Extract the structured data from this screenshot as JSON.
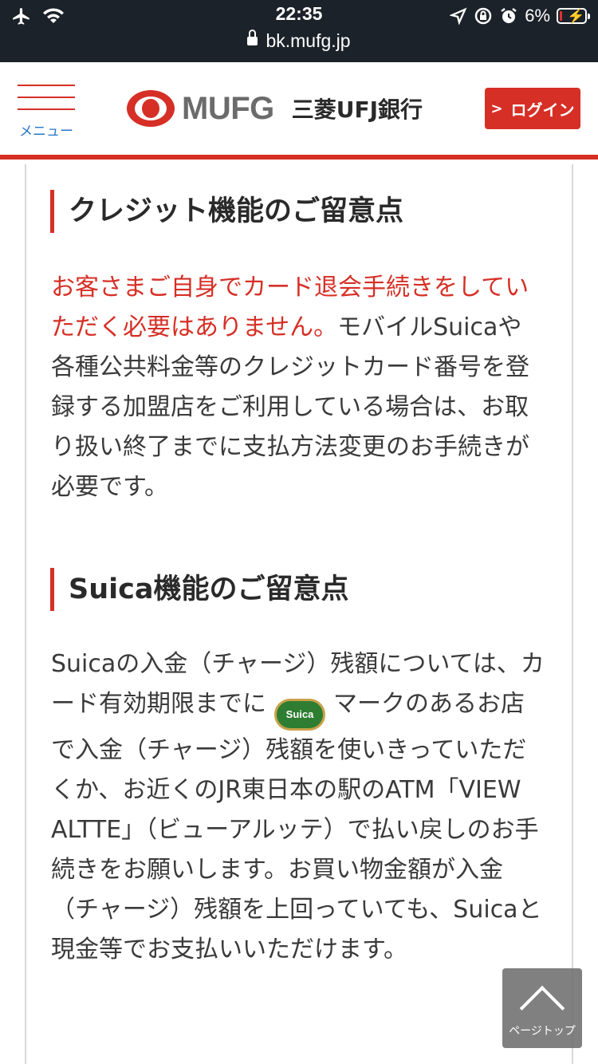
{
  "status_bar": {
    "time": "22:35",
    "battery": "6%",
    "url": "bk.mufg.jp"
  },
  "header": {
    "menu_label": "メニュー",
    "logo_text": "MUFG",
    "bank_name": "三菱UFJ銀行",
    "login_label": "ログイン",
    "accent_color": "#d62f26"
  },
  "sections": [
    {
      "heading": "クレジット機能のご留意点",
      "warning": "お客さまご自身でカード退会手続きをしていただく必要はありません。",
      "body": "モバイルSuicaや各種公共料金等のクレジットカード番号を登録する加盟店をご利用している場合は、お取り扱い終了までに支払方法変更のお手続きが必要です。"
    },
    {
      "heading": "Suica機能のご留意点",
      "body_before_mark": "Suicaの入金（チャージ）残額については、カード有効期限までに",
      "mark_label": "Suica",
      "body_after_mark": "マークのあるお店で入金（チャージ）残額を使いきっていただくか、お近くのJR東日本の駅のATM「VIEW ALTTE」（ビューアルッテ）で払い戻しのお手続きをお願いします。お買い物金額が入金（チャージ）残額を上回っていても、Suicaと現金等でお支払いいただけます。"
    }
  ],
  "page_top": {
    "label": "ページトップ"
  }
}
